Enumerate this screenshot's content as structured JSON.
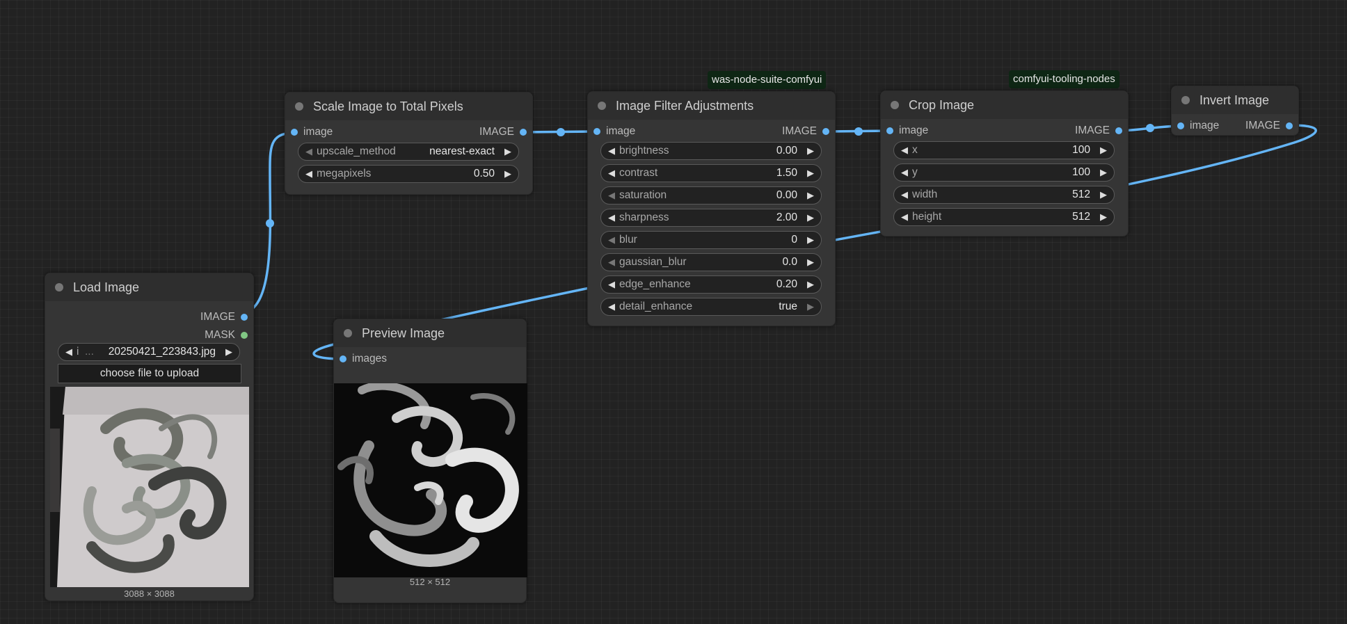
{
  "tags": {
    "was_suite": "was-node-suite-comfyui",
    "tooling": "comfyui-tooling-nodes"
  },
  "load_image": {
    "title": "Load Image",
    "out_image": "IMAGE",
    "out_mask": "MASK",
    "file_prefix": "i",
    "file_ellipsis": "...",
    "filename": "20250421_223843.jpg",
    "upload_label": "choose file to upload",
    "dimensions": "3088 × 3088"
  },
  "scale_image": {
    "title": "Scale Image to Total Pixels",
    "in_image": "image",
    "out_image": "IMAGE",
    "upscale_method_label": "upscale_method",
    "upscale_method_value": "nearest-exact",
    "megapixels_label": "megapixels",
    "megapixels_value": "0.50"
  },
  "filter": {
    "title": "Image Filter Adjustments",
    "in_image": "image",
    "out_image": "IMAGE",
    "widgets": [
      {
        "label": "brightness",
        "value": "0.00"
      },
      {
        "label": "contrast",
        "value": "1.50"
      },
      {
        "label": "saturation",
        "value": "0.00"
      },
      {
        "label": "sharpness",
        "value": "2.00"
      },
      {
        "label": "blur",
        "value": "0"
      },
      {
        "label": "gaussian_blur",
        "value": "0.0"
      },
      {
        "label": "edge_enhance",
        "value": "0.20"
      },
      {
        "label": "detail_enhance",
        "value": "true"
      }
    ]
  },
  "crop": {
    "title": "Crop Image",
    "in_image": "image",
    "out_image": "IMAGE",
    "widgets": [
      {
        "label": "x",
        "value": "100"
      },
      {
        "label": "y",
        "value": "100"
      },
      {
        "label": "width",
        "value": "512"
      },
      {
        "label": "height",
        "value": "512"
      }
    ]
  },
  "invert": {
    "title": "Invert Image",
    "in_image": "image",
    "out_image": "IMAGE"
  },
  "preview": {
    "title": "Preview Image",
    "in_images": "images",
    "dimensions": "512 × 512"
  },
  "icons": {
    "arrow_left": "◀",
    "arrow_right": "▶"
  },
  "colors": {
    "link": "#64b5f6",
    "mask_slot": "#81c784",
    "tag_bg": "#0e2614"
  }
}
